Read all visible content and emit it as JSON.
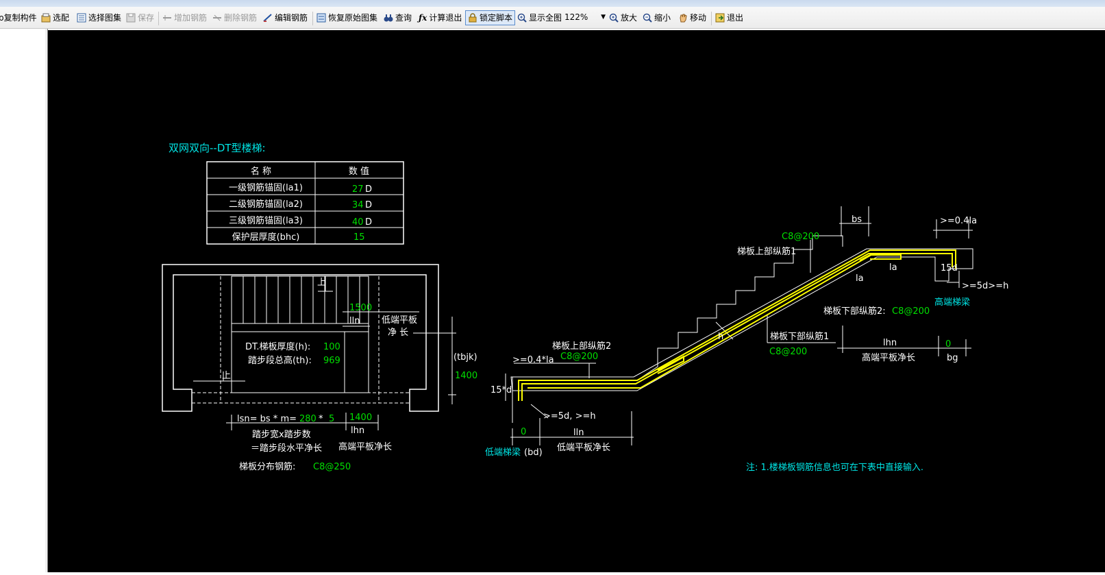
{
  "toolbar": {
    "copy": "复制构件",
    "match": "选配",
    "select_atlas": "选择图集",
    "save": "保存",
    "add_rebar": "增加钢筋",
    "delete_rebar": "删除钢筋",
    "edit_rebar": "编辑钢筋",
    "restore_atlas": "恢复原始图集",
    "query": "查询",
    "calc_exit": "计算退出",
    "lock_script": "锁定脚本",
    "show_all": "显示全图",
    "zoom_value": "122%",
    "zoom_in": "放大",
    "zoom_out": "缩小",
    "move": "移动",
    "exit": "退出"
  },
  "drawing": {
    "title": "双网双向--DT型楼梯:",
    "table": {
      "headers": [
        "名  称",
        "数  值"
      ],
      "rows": [
        {
          "name": "一级钢筋锚固(la1)",
          "value": "27",
          "unit": "D"
        },
        {
          "name": "二级钢筋锚固(la2)",
          "value": "34",
          "unit": "D"
        },
        {
          "name": "三级钢筋锚固(la3)",
          "value": "40",
          "unit": "D"
        },
        {
          "name": "保护层厚度(bhc)",
          "value": "15",
          "unit": ""
        }
      ]
    },
    "plan": {
      "up1": "上",
      "up2": "上",
      "val_1500": "1500",
      "lln": "lln",
      "low_platform_1": "低端平板",
      "low_platform_2": "净  长",
      "thickness_label": "DT.梯板厚度(h):",
      "thickness_value": "100",
      "height_label": "踏步段总高(th):",
      "height_value": "969",
      "tbjk": "(tbjk)",
      "val_1400_side": "1400",
      "lsn_label": "lsn= bs * m= ",
      "lsn_bs": "280",
      "lsn_star": " * ",
      "lsn_m": "5",
      "val_1400_bottom": "1400",
      "lhn": "lhn",
      "step_desc_1": "踏步宽x踏步数",
      "step_desc_2": "＝踏步段水平净长",
      "high_platform": "高端平板净长",
      "dist_label": "梯板分布钢筋:",
      "dist_value": "C8@250"
    },
    "section": {
      "bs": "bs",
      "ge_04la_top": ">=0.4la",
      "c8_200_top": "C8@200",
      "upper_long_1": "梯板上部纵筋1",
      "la_a": "la",
      "la_b": "la",
      "d15_right": "15d",
      "ge5d_right": ">=5d>=h",
      "high_beam": "高端梯梁",
      "lower_long_2_label": "梯板下部纵筋2:",
      "lower_long_2_value": "C8@200",
      "lower_long_1": "梯板下部纵筋1",
      "c8_200_lower1": "C8@200",
      "h": "h",
      "lhn": "lhn",
      "bg_value": "0",
      "high_platform_net": "高端平板净长",
      "bg": "bg",
      "upper_long_2": "梯板上部纵筋2",
      "c8_200_upper2": "C8@200",
      "ge_04la_left": ">=0.4*la",
      "d15_left": "15*d",
      "ge5d_left": ">=5d, >=h",
      "bd_value": "0",
      "lln": "lln",
      "low_beam": "低端梯梁",
      "bd": "(bd)",
      "low_platform_net": "低端平板净长"
    },
    "note": "注: 1.楼梯板钢筋信息也可在下表中直接输入."
  },
  "colors": {
    "canvas_bg": "#000000",
    "line": "#ffffff",
    "value_green": "#00e000",
    "title_cyan": "#00e5e5",
    "rebar_yellow": "#ffff00"
  },
  "icons": [
    "copy-icon",
    "match-icon",
    "select-atlas-icon",
    "save-icon",
    "add-rebar-icon",
    "delete-rebar-icon",
    "edit-rebar-icon",
    "restore-atlas-icon",
    "binoculars-icon",
    "function-icon",
    "lock-icon",
    "zoom-fit-icon",
    "zoom-in-icon",
    "zoom-out-icon",
    "hand-icon",
    "exit-icon"
  ]
}
